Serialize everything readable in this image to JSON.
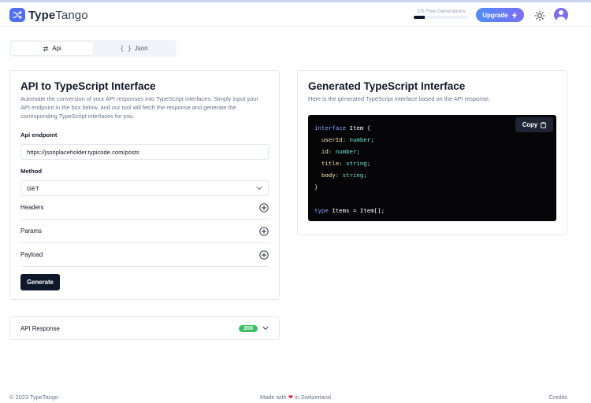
{
  "app": {
    "logo_bold": "Type",
    "logo_light": "Tango"
  },
  "header": {
    "generations_label": "1/5 Free Generations",
    "generations_progress": 0.2,
    "upgrade_label": "Upgrade"
  },
  "tabs": [
    {
      "label": "Api",
      "icon": "swap-icon",
      "active": true
    },
    {
      "label": "Json",
      "icon": "braces-icon",
      "active": false
    }
  ],
  "left_card": {
    "title": "API to TypeScript Interface",
    "description": "Automate the conversion of your API responses into TypeScript interfaces. Simply input your API endpoint in the box below, and our tool will fetch the response and generate the corresponding TypeScript interfaces for you.",
    "endpoint_label": "Api endpoint",
    "endpoint_value": "https://jsonplaceholder.typicode.com/posts",
    "method_label": "Method",
    "method_value": "GET",
    "sections": [
      "Headers",
      "Params",
      "Payload"
    ],
    "generate_label": "Generate"
  },
  "right_card": {
    "title": "Generated TypeScript Interface",
    "description": "Here is the generated TypeScript interface based on the API response.",
    "copy_label": "Copy",
    "code": {
      "kw_interface": "interface",
      "name_item": "Item",
      "brace_open": "{",
      "brace_close": "}",
      "fields": [
        {
          "name": "userId:",
          "type": "number;"
        },
        {
          "name": "id:",
          "type": "number;"
        },
        {
          "name": "title:",
          "type": "string;"
        },
        {
          "name": "body:",
          "type": "string;"
        }
      ],
      "kw_type": "type",
      "name_items": "Items",
      "assign": "= Item[];"
    }
  },
  "response": {
    "label": "API Response",
    "status": "200"
  },
  "footer": {
    "copyright": "© 2023 TypeTango",
    "made_prefix": "Made with",
    "made_suffix": "in Switzerland",
    "credits": "Credits"
  },
  "colors": {
    "accent": "#4f6ef2",
    "status_ok": "#3dbe63",
    "dark": "#0f172a"
  }
}
